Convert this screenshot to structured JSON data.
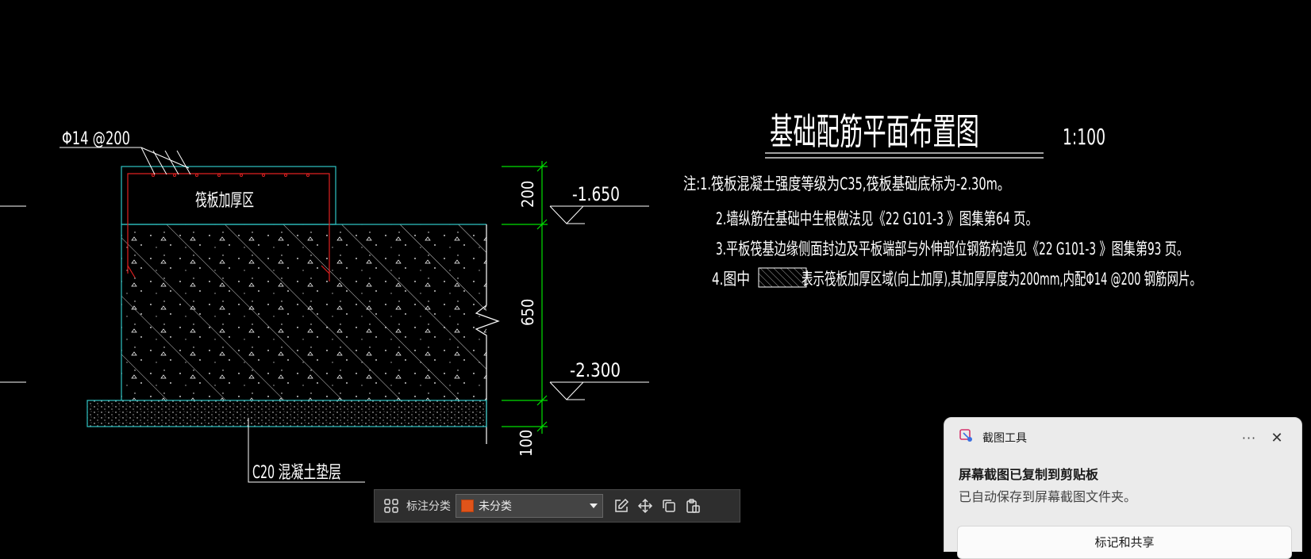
{
  "drawing": {
    "title": "基础配筋平面布置图",
    "scale": "1:100",
    "rebar_label": "Φ14 @200",
    "thicken_label": "筏板加厚区",
    "cushion_label": "C20 混凝土垫层",
    "elev_top": "-1.650",
    "elev_bottom": "-2.300",
    "dim_200": "200",
    "dim_650": "650",
    "dim_100": "100",
    "notes": [
      "注:1.筏板混凝土强度等级为C35,筏板基础底标为-2.30m。",
      "2.墙纵筋在基础中生根做法见《22 G101-3 》图集第64 页。",
      "3.平板筏基边缘侧面封边及平板端部与外伸部位钢筋构造见《22 G101-3 》图集第93 页。"
    ],
    "note4_prefix": "4.图中",
    "note4_suffix": "表示筏板加厚区域(向上加厚),其加厚厚度为200mm,内配Φ14 @200 钢筋网片。"
  },
  "toolbar": {
    "grid_icon": "apps-grid-icon",
    "category_label": "标注分类",
    "selected_category": "未分类",
    "swatch_color": "#e0541a",
    "actions": [
      "edit-icon",
      "move-icon",
      "copy-icon",
      "paste-icon"
    ]
  },
  "toast": {
    "app_name": "截图工具",
    "more": "···",
    "close": "✕",
    "title": "屏幕截图已复制到剪贴板",
    "subtitle": "已自动保存到屏幕截图文件夹。",
    "button": "标记和共享"
  },
  "colors": {
    "cyan": "#2ec4c4",
    "green": "#00e000",
    "red": "#e02020",
    "white": "#ffffff"
  }
}
